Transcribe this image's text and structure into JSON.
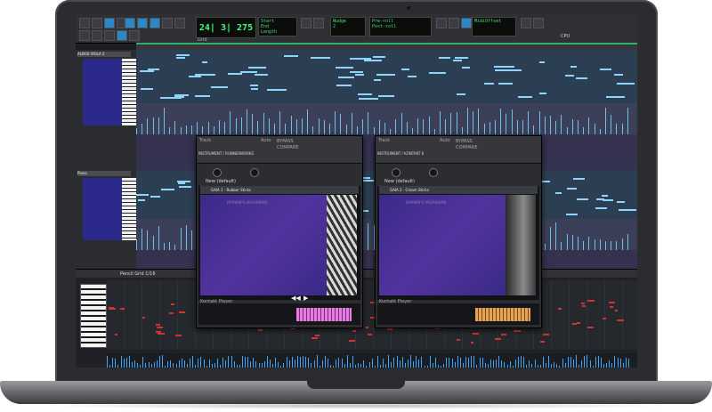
{
  "transport": {
    "counter": "24| 3| 275",
    "counter_sub": "Grid",
    "lcd1": [
      "Start",
      "End",
      "Length"
    ],
    "lcd2": [
      "Nudge",
      "2"
    ],
    "lcd3": [
      "Pre-roll",
      "Post-roll"
    ],
    "lcd4": [
      "MidiOffset"
    ],
    "cpu_label": "CPU"
  },
  "tracks": [
    {
      "name": "ALBOS VIOLA 2"
    },
    {
      "name": "Piano"
    }
  ],
  "editor": {
    "label": "Pencil Grid 1/16"
  },
  "plugins": [
    {
      "track_label": "Track",
      "title": "INSTRUMENT / RUNNERWORKS",
      "preset_label": "New (default)",
      "instrument_name": "GAIA 1 - Rubber Sticks",
      "watermark": "DARWIN'S ARGANISMS",
      "footer": "Kontakt Player",
      "auto_label": "Auto",
      "compare_label": "COMPARE",
      "bypass_label": "BYPASS",
      "accent": "#e27ce0"
    },
    {
      "track_label": "Track",
      "title": "INSTRUMENT / KONTAKT 6",
      "preset_label": "New (default)",
      "instrument_name": "GAIA 2 - Cream Sticks",
      "watermark": "DARWIN'S ARGANISMS",
      "footer": "Kontakt Player",
      "auto_label": "Auto",
      "compare_label": "COMPARE",
      "bypass_label": "BYPASS",
      "accent": "#e3a455"
    }
  ]
}
